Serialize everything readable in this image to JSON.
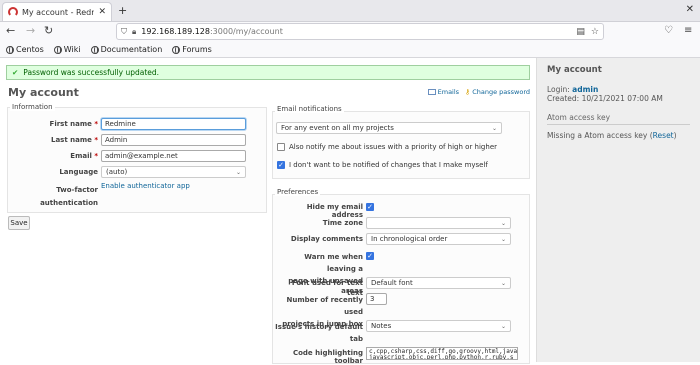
{
  "browser": {
    "tab_title": "My account - Redmine",
    "url_host": "192.168.189.128",
    "url_path": ":3000/my/account",
    "bookmarks": [
      "Centos",
      "Wiki",
      "Documentation",
      "Forums"
    ]
  },
  "flash": "Password was successfully updated.",
  "page_title": "My account",
  "contextual": {
    "emails": "Emails",
    "change_password": "Change password"
  },
  "information": {
    "legend": "Information",
    "first_name_label": "First name",
    "first_name": "Redmine",
    "last_name_label": "Last name",
    "last_name": "Admin",
    "email_label": "Email",
    "email": "admin@example.net",
    "language_label": "Language",
    "language": "(auto)",
    "twofa_label_1": "Two-factor",
    "twofa_label_2": "authentication",
    "twofa_link": "Enable authenticator app",
    "required_mark": "*"
  },
  "save_label": "Save",
  "email_notifications": {
    "legend": "Email notifications",
    "selected": "For any event on all my projects",
    "notify_high_priority": "Also notify me about issues with a priority of high or higher",
    "notify_high_priority_checked": false,
    "no_self_notified": "I don't want to be notified of changes that I make myself",
    "no_self_notified_checked": true
  },
  "preferences": {
    "legend": "Preferences",
    "hide_mail_label": "Hide my email address",
    "hide_mail_checked": true,
    "time_zone_label": "Time zone",
    "time_zone": "",
    "display_comments_label": "Display comments",
    "display_comments": "In chronological order",
    "warn_label_1": "Warn me when leaving a",
    "warn_label_2": "page with unsaved text",
    "warn_checked": true,
    "font_label": "Font used for text areas",
    "font": "Default font",
    "recent_label_1": "Number of recently used",
    "recent_label_2": "projects in jump box",
    "recent_value": "3",
    "history_label_1": "Issue's history default",
    "history_label_2": "tab",
    "history_value": "Notes",
    "code_label": "Code highlighting toolbar",
    "code_value": "c,cpp,csharp,css,diff,go,groovy,html,java javascript,objc,perl,php,python,r,ruby,s"
  },
  "sidebar": {
    "title": "My account",
    "login_label": "Login:",
    "login_value": "admin",
    "created_label": "Created:",
    "created_value": "10/21/2021 07:00 AM",
    "atom_heading": "Atom access key",
    "atom_missing": "Missing a Atom access key",
    "reset_open": "(",
    "reset_label": "Reset",
    "reset_close": ")"
  },
  "colors": {
    "accent_link": "#1166aa",
    "flash_bg": "#dfffdf",
    "checkbox": "#3574e0"
  }
}
